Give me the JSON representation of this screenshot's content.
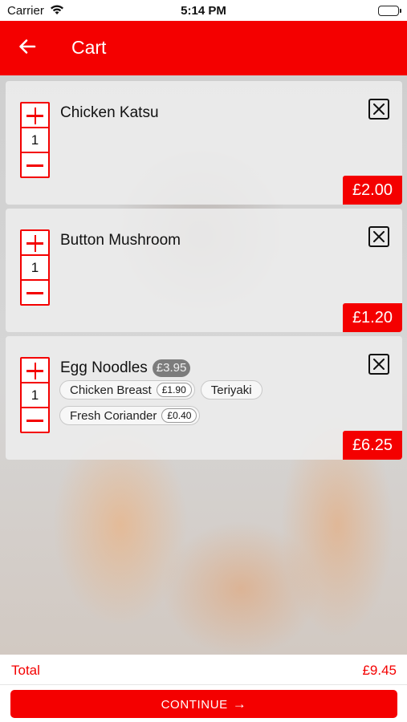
{
  "status_bar": {
    "carrier": "Carrier",
    "time": "5:14 PM"
  },
  "header": {
    "title": "Cart",
    "back_icon": "arrow-left-icon"
  },
  "cart": {
    "items": [
      {
        "name": "Chicken Katsu",
        "quantity": "1",
        "price": "£2.00",
        "base_price": "",
        "options": []
      },
      {
        "name": "Button Mushroom",
        "quantity": "1",
        "price": "£1.20",
        "base_price": "",
        "options": []
      },
      {
        "name": "Egg Noodles",
        "quantity": "1",
        "price": "£6.25",
        "base_price": "£3.95",
        "options": [
          {
            "label": "Chicken Breast",
            "price": "£1.90"
          },
          {
            "label": "Teriyaki",
            "price": ""
          },
          {
            "label": "Fresh Coriander",
            "price": "£0.40"
          }
        ]
      }
    ]
  },
  "footer": {
    "total_label": "Total",
    "total_value": "£9.45",
    "continue_label": "CONTINUE"
  },
  "colors": {
    "accent": "#f40000",
    "background": "#d8d8d8"
  }
}
